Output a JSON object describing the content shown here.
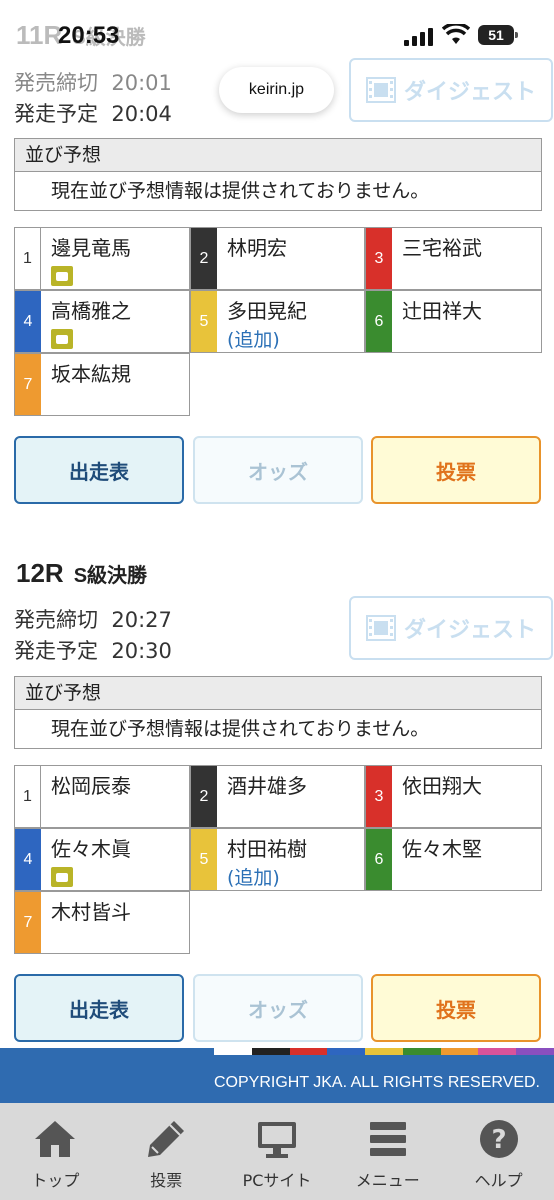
{
  "status": {
    "time": "20:53",
    "battery": "51"
  },
  "browser": {
    "url": "keirin.jp"
  },
  "races": [
    {
      "title": "11R",
      "subtitle": "S級決勝",
      "close_label": "発売締切",
      "close_time": "20:01",
      "start_label": "発走予定",
      "start_time": "20:04",
      "digest": "ダイジェスト",
      "narabi_header": "並び予想",
      "narabi_msg": "現在並び予想情報は提供されておりません。",
      "riders": [
        {
          "num": "1",
          "name": "邊見竜馬",
          "like": true,
          "add": ""
        },
        {
          "num": "2",
          "name": "林明宏",
          "like": false,
          "add": ""
        },
        {
          "num": "3",
          "name": "三宅裕武",
          "like": false,
          "add": ""
        },
        {
          "num": "4",
          "name": "高橋雅之",
          "like": true,
          "add": ""
        },
        {
          "num": "5",
          "name": "多田晃紀",
          "like": false,
          "add": "(追加)"
        },
        {
          "num": "6",
          "name": "辻田祥大",
          "like": false,
          "add": ""
        },
        {
          "num": "7",
          "name": "坂本紘規",
          "like": false,
          "add": ""
        }
      ],
      "buttons": {
        "entry": "出走表",
        "odds": "オッズ",
        "vote": "投票"
      }
    },
    {
      "title": "12R",
      "subtitle": "S級決勝",
      "close_label": "発売締切",
      "close_time": "20:27",
      "start_label": "発走予定",
      "start_time": "20:30",
      "digest": "ダイジェスト",
      "narabi_header": "並び予想",
      "narabi_msg": "現在並び予想情報は提供されておりません。",
      "riders": [
        {
          "num": "1",
          "name": "松岡辰泰",
          "like": false,
          "add": ""
        },
        {
          "num": "2",
          "name": "酒井雄多",
          "like": false,
          "add": ""
        },
        {
          "num": "3",
          "name": "依田翔大",
          "like": false,
          "add": ""
        },
        {
          "num": "4",
          "name": "佐々木眞",
          "like": true,
          "add": ""
        },
        {
          "num": "5",
          "name": "村田祐樹",
          "like": false,
          "add": "(追加)"
        },
        {
          "num": "6",
          "name": "佐々木堅",
          "like": false,
          "add": ""
        },
        {
          "num": "7",
          "name": "木村皆斗",
          "like": false,
          "add": ""
        }
      ],
      "buttons": {
        "entry": "出走表",
        "odds": "オッズ",
        "vote": "投票"
      }
    }
  ],
  "colors": {
    "n1": "#ffffff",
    "n2": "#333333",
    "n3": "#d8302a",
    "n4": "#2e66c0",
    "n5": "#e8c33a",
    "n6": "#3a8c2f",
    "n7": "#ee9a30",
    "footer": "#2f6bb0"
  },
  "footer": {
    "copyright": "COPYRIGHT JKA. ALL RIGHTS RESERVED."
  },
  "tabbar": [
    {
      "label": "トップ",
      "icon": "home-icon"
    },
    {
      "label": "投票",
      "icon": "pencil-icon"
    },
    {
      "label": "PCサイト",
      "icon": "monitor-icon"
    },
    {
      "label": "メニュー",
      "icon": "menu-icon"
    },
    {
      "label": "ヘルプ",
      "icon": "help-icon"
    }
  ]
}
